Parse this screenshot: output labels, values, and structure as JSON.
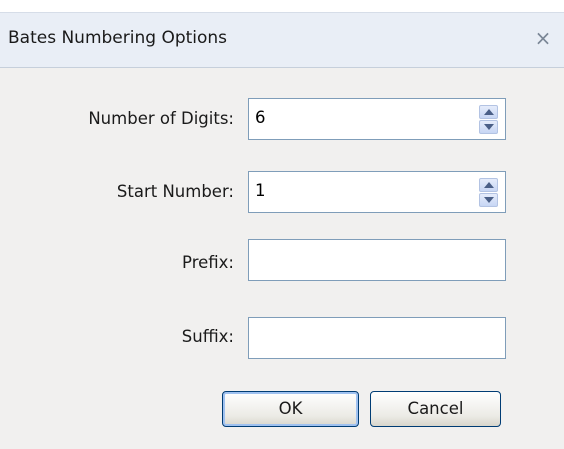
{
  "dialog": {
    "title": "Bates Numbering Options",
    "close_glyph": "×"
  },
  "fields": {
    "digits": {
      "label": "Number of Digits:",
      "value": "6"
    },
    "start": {
      "label": "Start Number:",
      "value": "1"
    },
    "prefix": {
      "label": "Prefix:",
      "value": ""
    },
    "suffix": {
      "label": "Suffix:",
      "value": ""
    }
  },
  "buttons": {
    "ok_label": "OK",
    "cancel_label": "Cancel"
  }
}
